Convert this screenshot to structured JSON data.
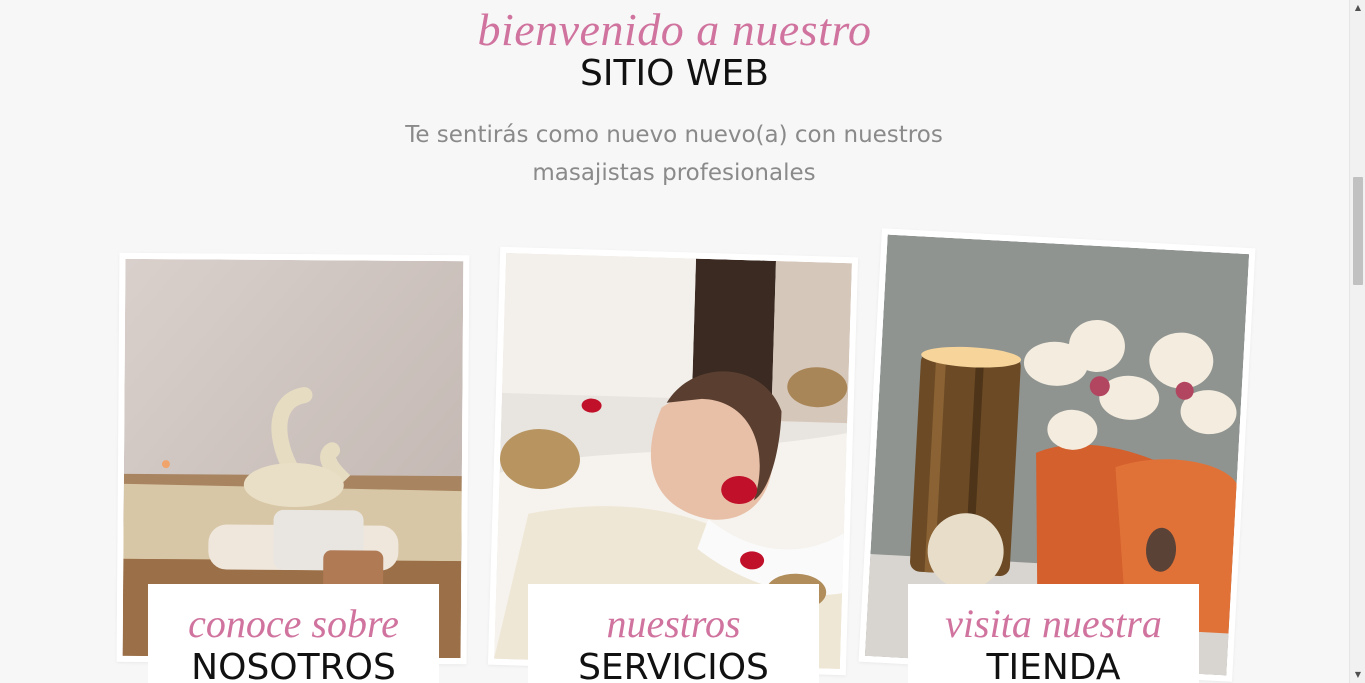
{
  "welcome": {
    "script": "bienvenido a nuestro",
    "heading": "SITIO WEB",
    "subtitle": "Te sentirás como nuevo nuevo(a) con nuestros masajistas profesionales"
  },
  "cards": [
    {
      "script": "conoce sobre",
      "heading": "NOSOTROS",
      "image": "spa-room-towel-swan"
    },
    {
      "script": "nuestros",
      "heading": "SERVICIOS",
      "image": "woman-massage-singing-bowls"
    },
    {
      "script": "visita nuestra",
      "heading": "TIENDA",
      "image": "candle-orchid-towels"
    }
  ],
  "colors": {
    "accent_pink": "#d0739e",
    "background": "#f7f7f7",
    "heading": "#111111",
    "subtitle": "#8a8a8a"
  },
  "scrollbar": {
    "up_icon": "arrow-up-icon",
    "down_icon": "arrow-down-icon"
  }
}
